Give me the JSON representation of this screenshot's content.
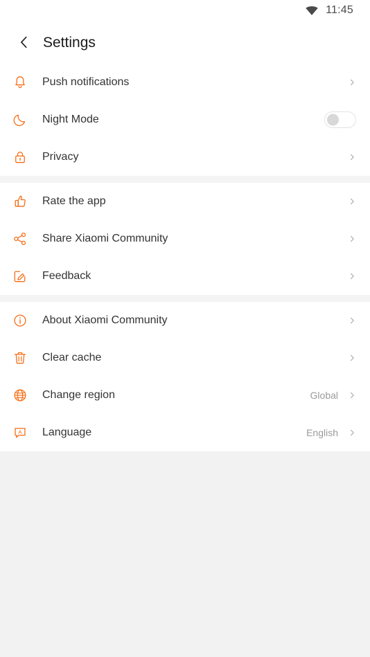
{
  "status_bar": {
    "wifi_icon": "wifi-icon",
    "time": "11:45"
  },
  "header": {
    "back_icon": "chevron-left-icon",
    "title": "Settings"
  },
  "colors": {
    "accent": "#f56c13",
    "page_background": "#f2f2f3",
    "card_background": "#ffffff",
    "divider": "#f4f4f5",
    "label_text": "#333333",
    "value_text": "#9a9a9a",
    "chevron": "#8c8c8c"
  },
  "groups": [
    {
      "name": "preferences",
      "items": [
        {
          "label": "Push notifications",
          "icon": "bell-icon",
          "accessory": "chevron",
          "value": ""
        },
        {
          "label": "Night Mode",
          "icon": "moon-icon",
          "accessory": "toggle",
          "toggle_on": false,
          "value": ""
        },
        {
          "label": "Privacy",
          "icon": "lock-icon",
          "accessory": "chevron",
          "value": ""
        }
      ]
    },
    {
      "name": "engagement",
      "items": [
        {
          "label": "Rate the app",
          "icon": "thumbs-up-icon",
          "accessory": "chevron",
          "value": ""
        },
        {
          "label": "Share Xiaomi Community",
          "icon": "share-icon",
          "accessory": "chevron",
          "value": ""
        },
        {
          "label": "Feedback",
          "icon": "edit-square-icon",
          "accessory": "chevron",
          "value": ""
        }
      ]
    },
    {
      "name": "general",
      "items": [
        {
          "label": "About Xiaomi Community",
          "icon": "info-circle-icon",
          "accessory": "chevron",
          "value": ""
        },
        {
          "label": "Clear cache",
          "icon": "trash-icon",
          "accessory": "chevron",
          "value": ""
        },
        {
          "label": "Change region",
          "icon": "globe-icon",
          "accessory": "chevron",
          "value": "Global"
        },
        {
          "label": "Language",
          "icon": "language-bubble-icon",
          "accessory": "chevron",
          "value": "English"
        }
      ]
    }
  ]
}
